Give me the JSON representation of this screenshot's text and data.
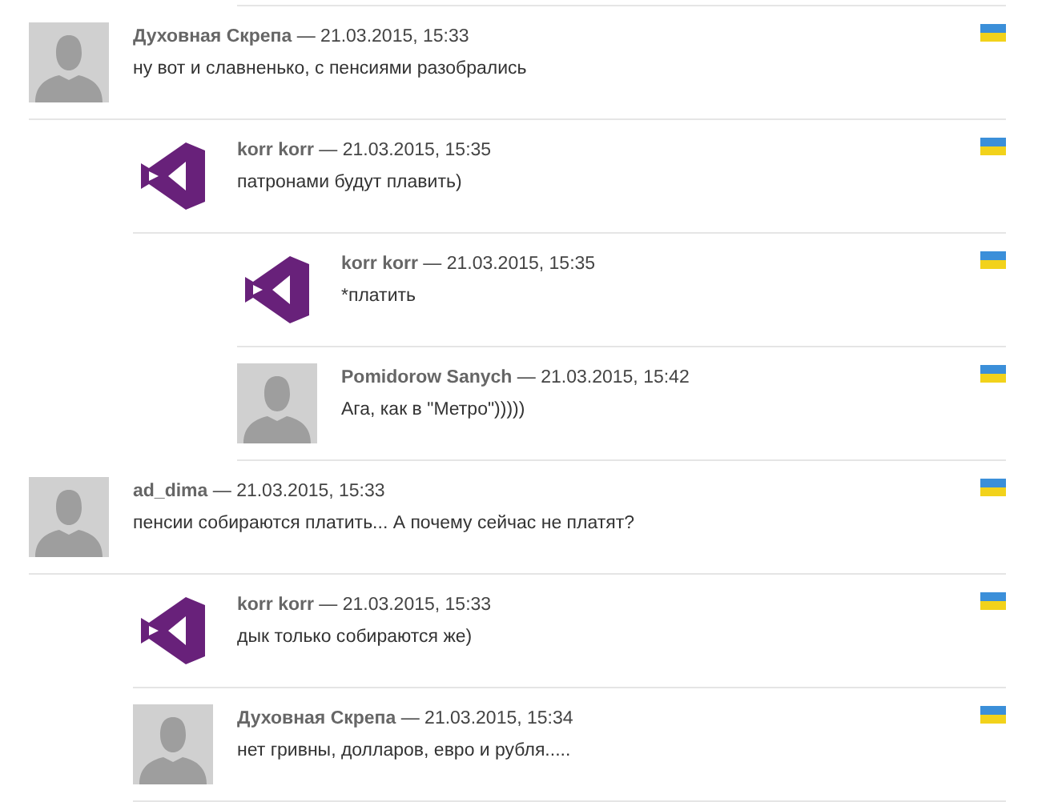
{
  "comments": [
    {
      "author": "Духовная Скрепа",
      "date": "— 21.03.2015, 15:33",
      "text": "ну вот и славненько, с пенсиями разобрались",
      "kind": "silhouette",
      "children": [
        {
          "author": "korr korr",
          "date": "— 21.03.2015, 15:35",
          "text": "патронами будут плавить)",
          "kind": "logo",
          "children": [
            {
              "author": "korr korr",
              "date": "— 21.03.2015, 15:35",
              "text": "*платить",
              "kind": "logo"
            },
            {
              "author": "Pomidorow Sanych",
              "date": "— 21.03.2015, 15:42",
              "text": "Ага, как в \"Метро\")))))",
              "kind": "silhouette"
            }
          ]
        }
      ]
    },
    {
      "author": "ad_dima",
      "date": "— 21.03.2015, 15:33",
      "text": "пенсии собираются платить... А почему сейчас не платят?",
      "kind": "silhouette",
      "children": [
        {
          "author": "korr korr",
          "date": "— 21.03.2015, 15:33",
          "text": "дык только собираются же)",
          "kind": "logo"
        },
        {
          "author": "Духовная Скрепа",
          "date": "— 21.03.2015, 15:34",
          "text": "нет гривны, долларов, евро и рубля.....",
          "kind": "silhouette"
        }
      ]
    }
  ]
}
